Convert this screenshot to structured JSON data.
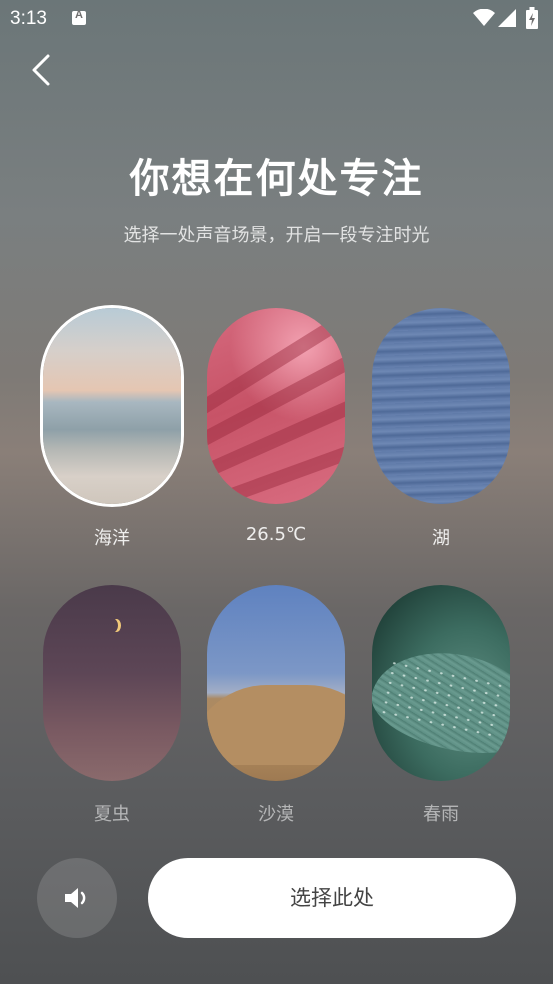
{
  "status_bar": {
    "time": "3:13"
  },
  "header": {
    "title": "你想在何处专注",
    "subtitle": "选择一处声音场景，开启一段专注时光"
  },
  "scenes": [
    {
      "label": "海洋",
      "selected": true
    },
    {
      "label": "26.5℃",
      "selected": false
    },
    {
      "label": "湖",
      "selected": false
    },
    {
      "label": "夏虫",
      "selected": false
    },
    {
      "label": "沙漠",
      "selected": false
    },
    {
      "label": "春雨",
      "selected": false
    }
  ],
  "actions": {
    "select_label": "选择此处"
  },
  "colors": {
    "accent": "#ffffff",
    "button_text": "#444444"
  }
}
